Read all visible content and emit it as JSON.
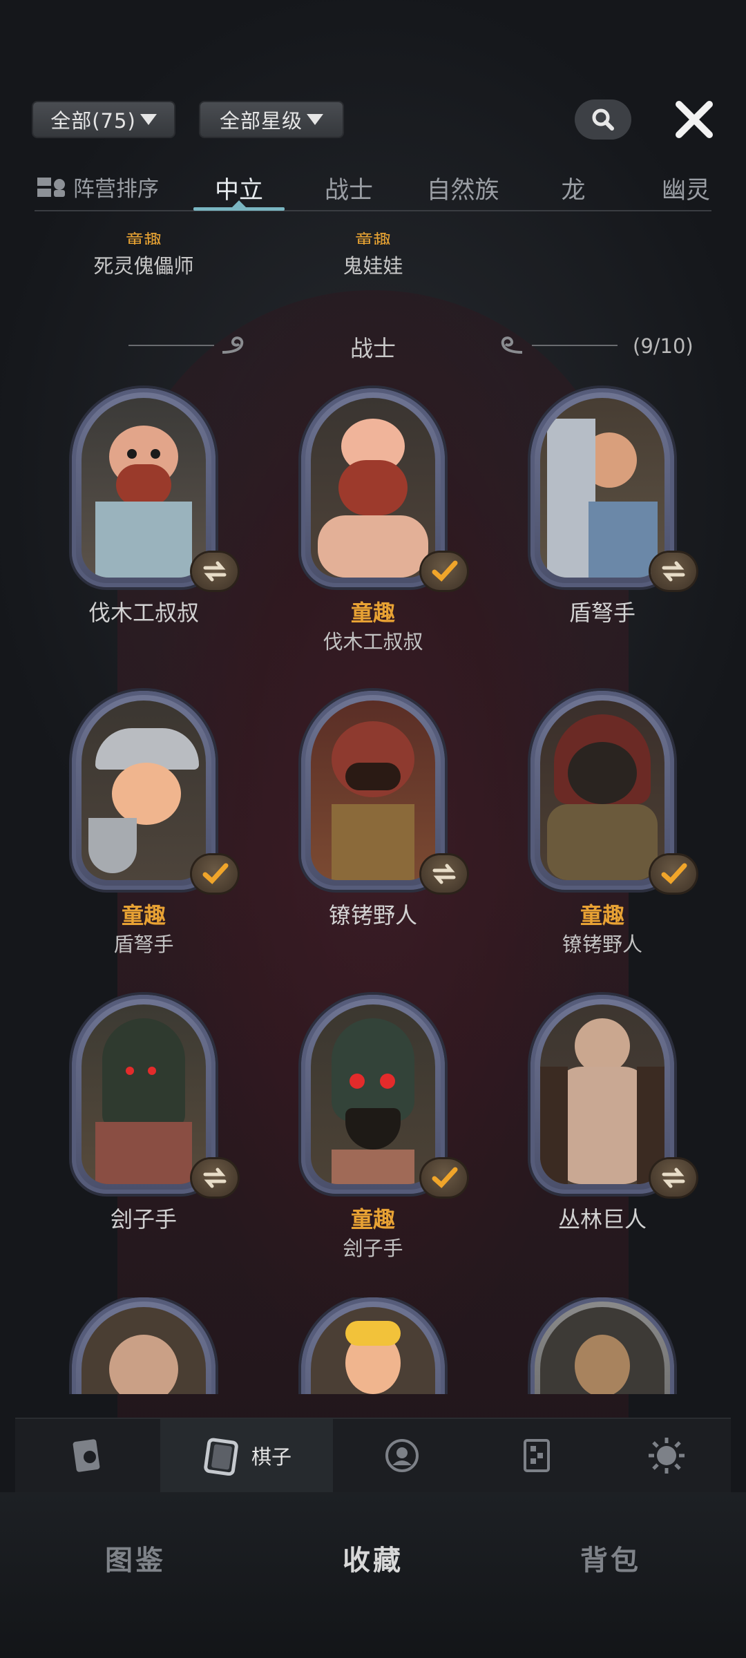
{
  "filters": {
    "faction_filter": "全部(75)",
    "star_filter": "全部星级"
  },
  "tabs": {
    "sort_label": "阵营排序",
    "items": [
      "中立",
      "战士",
      "自然族",
      "龙",
      "幽灵"
    ],
    "active": "中立"
  },
  "previous_row": [
    {
      "tag": "童趣",
      "name": "死灵傀儡师"
    },
    {
      "tag": "童趣",
      "name": "鬼娃娃"
    }
  ],
  "section": {
    "title": "战士",
    "count": "(9/10)"
  },
  "cards": [
    {
      "name": "伐木工叔叔",
      "tag": "",
      "sub": "",
      "badge": "swap"
    },
    {
      "name": "",
      "tag": "童趣",
      "sub": "伐木工叔叔",
      "badge": "check"
    },
    {
      "name": "盾弩手",
      "tag": "",
      "sub": "",
      "badge": "swap"
    },
    {
      "name": "",
      "tag": "童趣",
      "sub": "盾弩手",
      "badge": "check"
    },
    {
      "name": "镣铐野人",
      "tag": "",
      "sub": "",
      "badge": "swap"
    },
    {
      "name": "",
      "tag": "童趣",
      "sub": "镣铐野人",
      "badge": "check"
    },
    {
      "name": "刽子手",
      "tag": "",
      "sub": "",
      "badge": "swap"
    },
    {
      "name": "",
      "tag": "童趣",
      "sub": "刽子手",
      "badge": "check"
    },
    {
      "name": "丛林巨人",
      "tag": "",
      "sub": "",
      "badge": "swap"
    }
  ],
  "subnav": {
    "items": [
      {
        "icon": "card-ghost-icon",
        "label": ""
      },
      {
        "icon": "chess-piece-icon",
        "label": "棋子"
      },
      {
        "icon": "portrait-icon",
        "label": ""
      },
      {
        "icon": "board-icon",
        "label": ""
      },
      {
        "icon": "sun-icon",
        "label": ""
      }
    ],
    "active_index": 1
  },
  "bottom_tabs": {
    "items": [
      "图鉴",
      "收藏",
      "背包"
    ],
    "active": "收藏"
  },
  "colors": {
    "accent_tab": "#7ab6c2",
    "tag_orange": "#e8a234",
    "badge_check": "#f0a52a",
    "frame_purple": "#6f7593"
  }
}
